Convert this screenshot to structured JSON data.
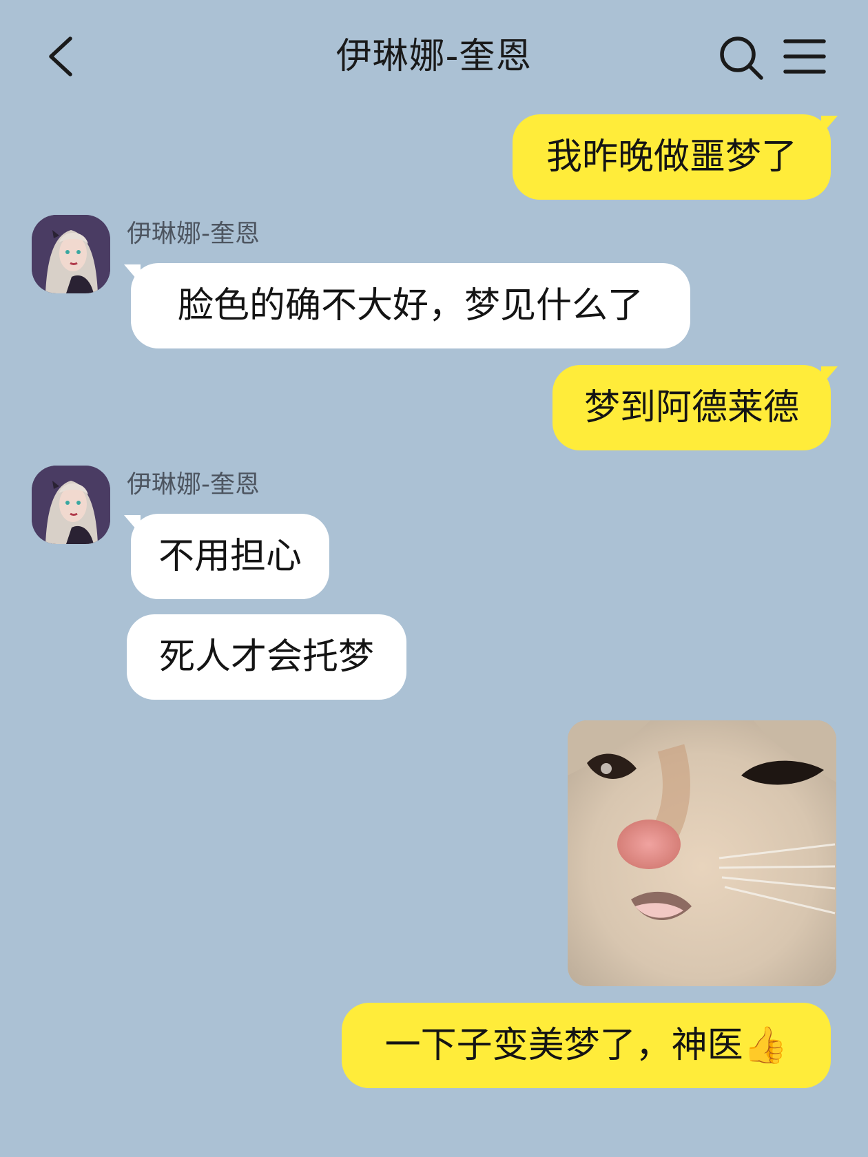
{
  "header": {
    "title": "伊琳娜-奎恩"
  },
  "messages": [
    {
      "sender": "me",
      "text": "我昨晚做噩梦了"
    },
    {
      "sender": "them",
      "name": "伊琳娜-奎恩",
      "text": "脸色的确不大好，梦见什么了"
    },
    {
      "sender": "me",
      "text": "梦到阿德莱德"
    },
    {
      "sender": "them",
      "name": "伊琳娜-奎恩",
      "text": "不用担心"
    },
    {
      "sender": "them",
      "text": "死人才会托梦"
    },
    {
      "sender": "me",
      "type": "sticker",
      "description": "cat-sticker"
    },
    {
      "sender": "me",
      "text": "一下子变美梦了，神医👍"
    }
  ],
  "colors": {
    "background": "#abc1d4",
    "my_bubble": "#ffec3a",
    "their_bubble": "#ffffff",
    "name_text": "#4d5560"
  },
  "icons": {
    "back": "chevron-left-icon",
    "search": "search-icon",
    "menu": "menu-icon"
  }
}
